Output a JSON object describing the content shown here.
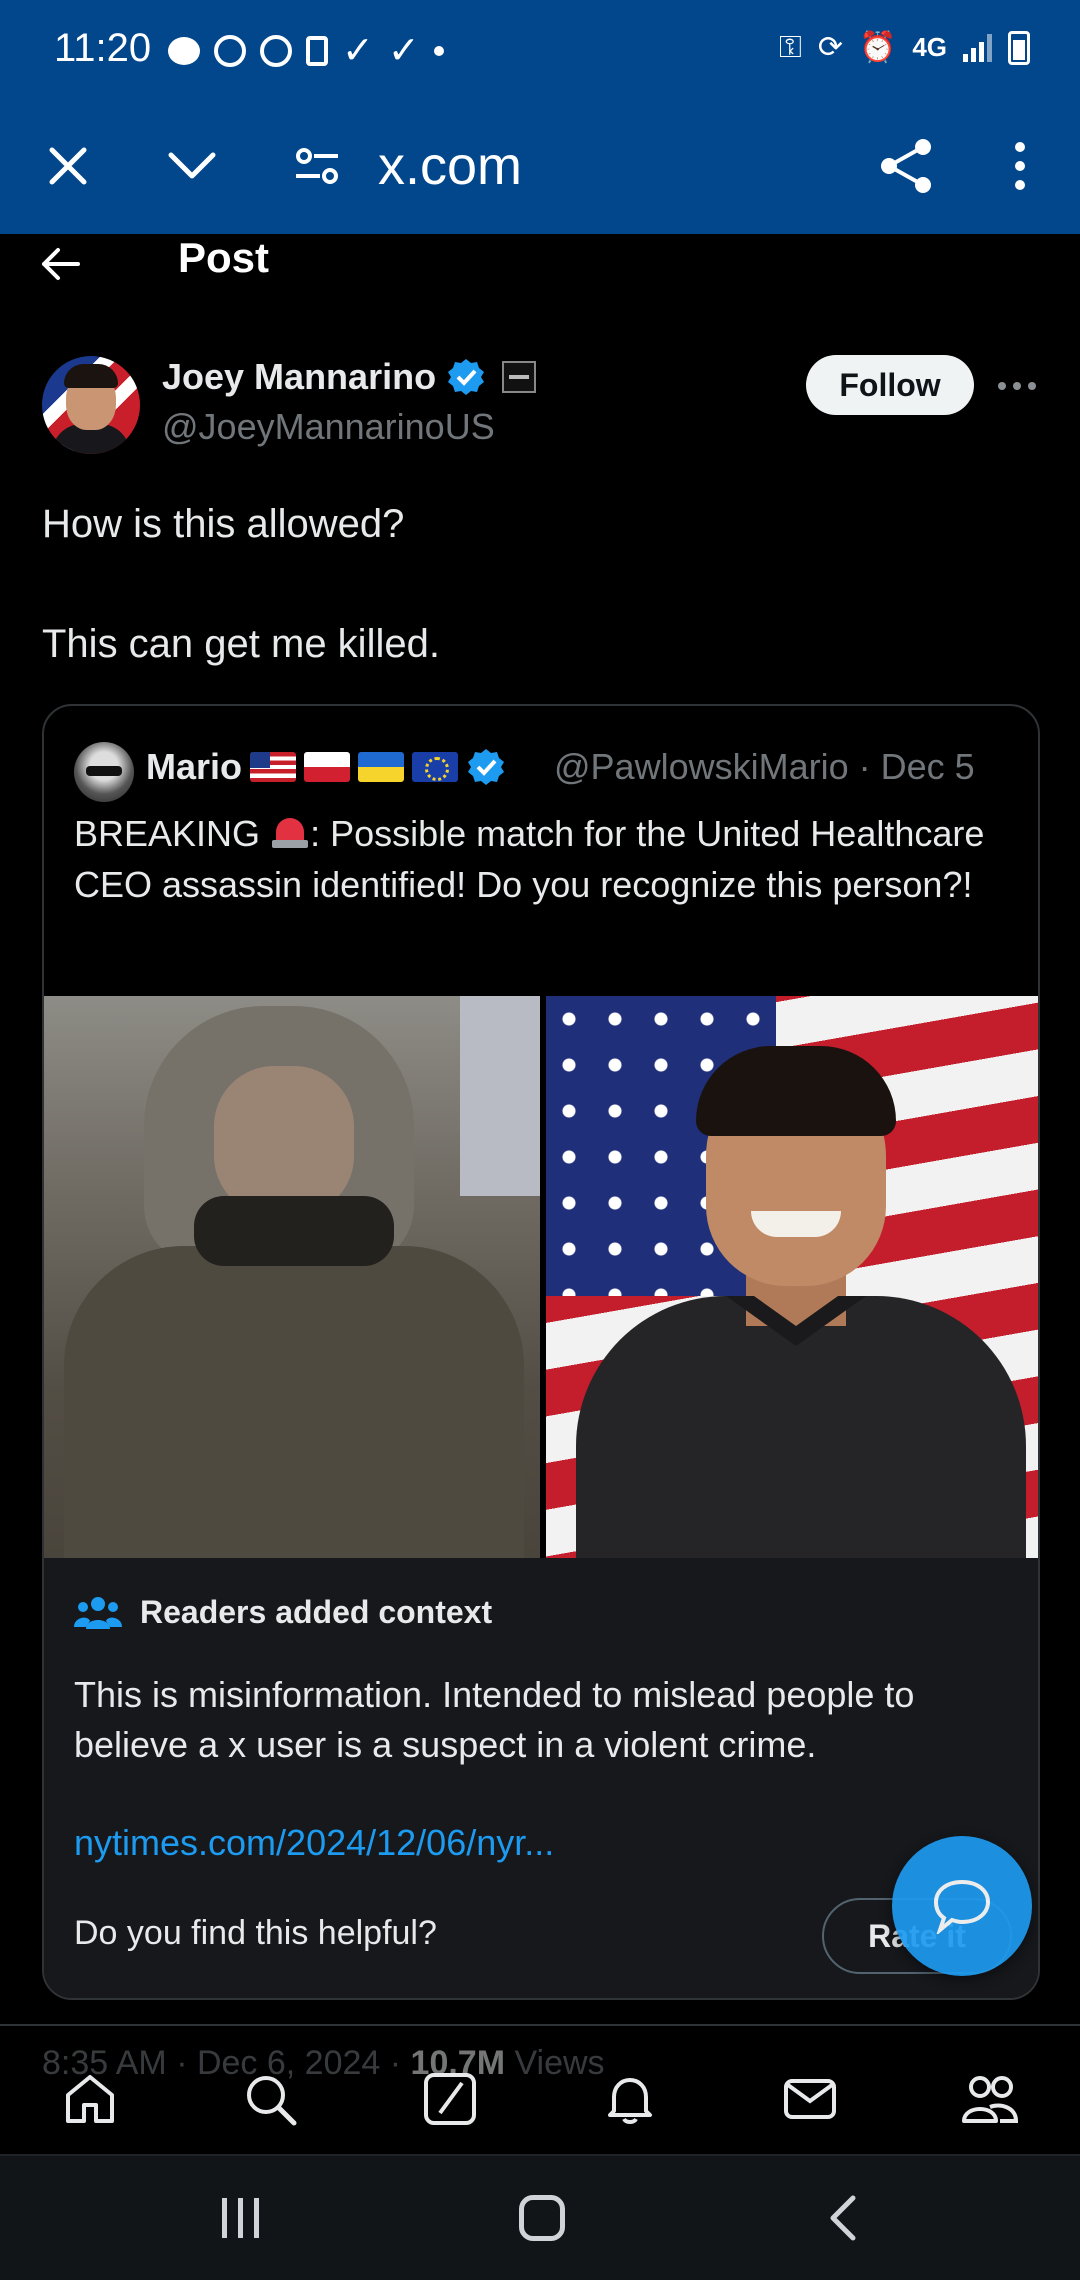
{
  "status_bar": {
    "time": "11:20",
    "network": "4G"
  },
  "browser": {
    "url": "x.com"
  },
  "header": {
    "title": "Post"
  },
  "post": {
    "author_name": "Joey Mannarino",
    "author_handle": "@JoeyMannarinoUS",
    "follow_label": "Follow",
    "text_line1": "How is this allowed?",
    "text_line2": "This can get me killed.",
    "timestamp": "8:35 AM · Dec 6, 2024 · ",
    "views_count": "10.7M",
    "views_label": " Views"
  },
  "quote": {
    "author_name": "Mario",
    "handle_date": "@PawlowskiMario · Dec 5",
    "text_prefix": "BREAKING ",
    "text_body": ": Possible match for the United Healthcare CEO assassin identified! Do you recognize this person?!"
  },
  "notes": {
    "title": "Readers added context",
    "body": "This is misinformation. Intended to mislead people to believe a x user is a suspect in a violent crime.",
    "link": "nytimes.com/2024/12/06/nyr...",
    "helpful_question": "Do you find this helpful?",
    "rate_label": "Rate it"
  },
  "colors": {
    "brand_bar": "#02468b",
    "link": "#1d9bf0",
    "verified": "#1d9bf0"
  },
  "icons": {
    "browser": [
      "close-icon",
      "chevron-down-icon",
      "site-settings-icon",
      "share-icon",
      "more-vertical-icon"
    ],
    "tabbar": [
      "home-icon",
      "search-icon",
      "grok-icon",
      "notifications-icon",
      "messages-icon",
      "communities-icon"
    ],
    "system_nav": [
      "recent-apps-icon",
      "home-icon",
      "back-icon"
    ]
  }
}
